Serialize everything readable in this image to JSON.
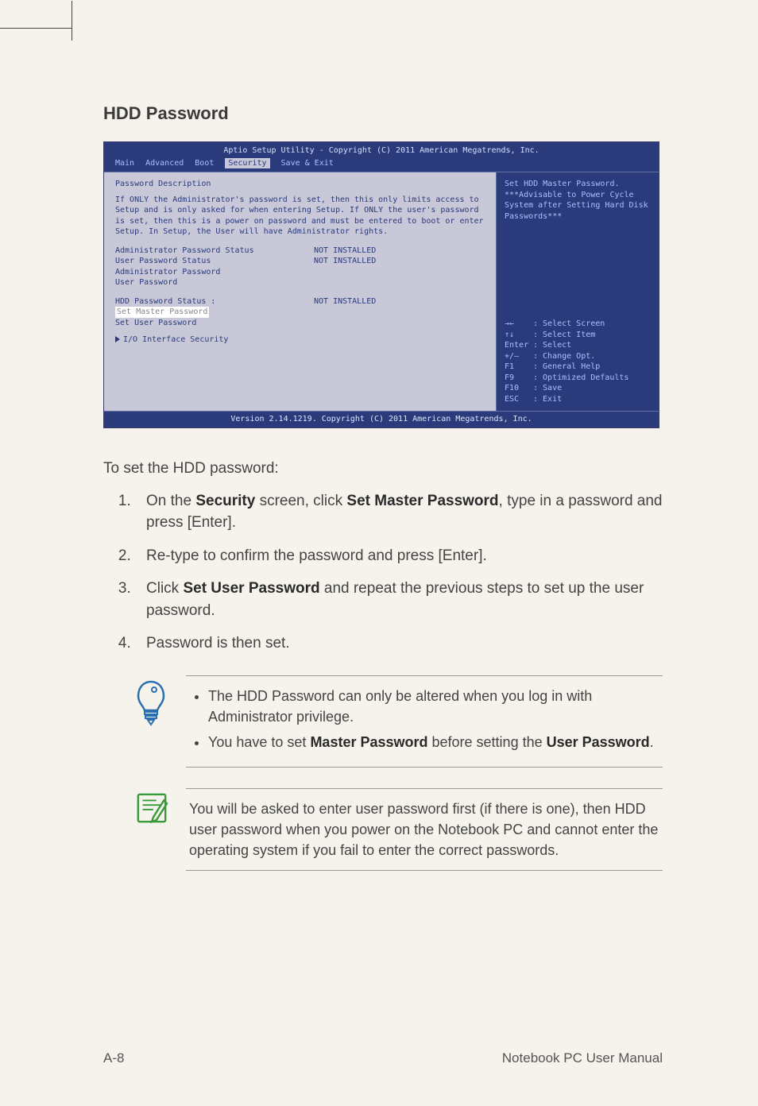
{
  "heading": "HDD Password",
  "bios": {
    "title": "Aptio Setup Utility - Copyright (C) 2011 American Megatrends, Inc.",
    "tabs": [
      "Main",
      "Advanced",
      "Boot",
      "Security",
      "Save & Exit"
    ],
    "active_tab": "Security",
    "left": {
      "section_title": "Password Description",
      "description": "If ONLY the Administrator's password is set, then this only limits access to Setup and is only asked for when entering Setup. If ONLY the user's password is set, then this is a power on password and must be entered to boot or enter Setup. In Setup, the User will have Administrator rights.",
      "rows": [
        {
          "label": "Administrator Password Status",
          "value": "NOT INSTALLED"
        },
        {
          "label": "User Password Status",
          "value": "NOT INSTALLED"
        }
      ],
      "items1": [
        "Administrator Password",
        "User Password"
      ],
      "hdd_status_label": "HDD Password Status :",
      "hdd_status_value": "NOT INSTALLED",
      "hdd_items": [
        "Set Master Password",
        "Set User Password"
      ],
      "io_item": "I/O Interface Security"
    },
    "right": {
      "help1": "Set HDD Master Password.",
      "help2": "***Advisable to Power Cycle System after Setting Hard Disk Passwords***",
      "keys": [
        {
          "k": "→←",
          "d": ": Select Screen"
        },
        {
          "k": "↑↓",
          "d": ": Select Item"
        },
        {
          "k": "Enter",
          "d": ": Select"
        },
        {
          "k": "+/—",
          "d": ": Change Opt."
        },
        {
          "k": "F1",
          "d": ": General Help"
        },
        {
          "k": "F9",
          "d": ": Optimized Defaults"
        },
        {
          "k": "F10",
          "d": ": Save"
        },
        {
          "k": "ESC",
          "d": ": Exit"
        }
      ]
    },
    "footer": "Version 2.14.1219. Copyright (C) 2011 American Megatrends, Inc."
  },
  "lead": "To set the HDD password:",
  "steps": {
    "s1a": "On the ",
    "s1b": "Security",
    "s1c": " screen, click ",
    "s1d": "Set Master Password",
    "s1e": ", type in a password and press [Enter].",
    "s2": "Re-type to confirm the password and press [Enter].",
    "s3a": "Click ",
    "s3b": "Set User Password",
    "s3c": " and repeat the previous steps to set up the user password.",
    "s4": "Password is then set."
  },
  "callout1": {
    "li1": "The HDD Password can only be altered when you log in with Administrator privilege.",
    "li2a": "You have to set ",
    "li2b": "Master Password",
    "li2c": " before setting the ",
    "li2d": "User Password",
    "li2e": "."
  },
  "callout2": "You will be asked to enter user password first (if there is one), then HDD user password when you power on the Notebook PC and cannot enter the operating system if you fail to enter the correct passwords.",
  "footer_left": "A-8",
  "footer_right": "Notebook PC User Manual"
}
